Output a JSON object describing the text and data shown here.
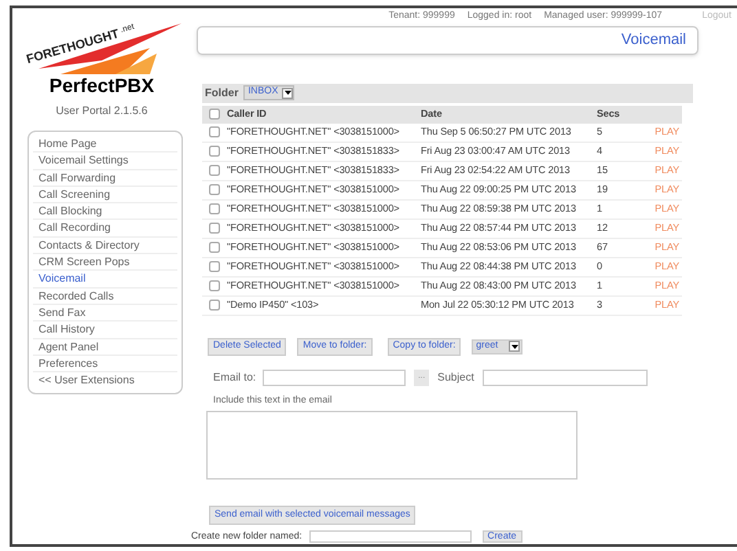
{
  "header": {
    "tenant": "Tenant: 999999",
    "logged_in": "Logged in: root",
    "managed_user": "Managed user: 999999-107",
    "logout": "Logout",
    "page_title": "Voicemail"
  },
  "logo": {
    "brand": "FORETHOUGHT",
    "suffix": ".net",
    "product": "PerfectPBX",
    "version": "User Portal 2.1.5.6"
  },
  "sidebar": {
    "items": [
      {
        "label": "Home Page",
        "selected": false
      },
      {
        "label": "Voicemail Settings",
        "selected": false
      },
      {
        "label": "Call Forwarding",
        "selected": false
      },
      {
        "label": "Call Screening",
        "selected": false
      },
      {
        "label": "Call Blocking",
        "selected": false
      },
      {
        "label": "Call Recording",
        "selected": false
      },
      {
        "label": "Contacts & Directory",
        "selected": false
      },
      {
        "label": "CRM Screen Pops",
        "selected": false
      },
      {
        "label": "Voicemail",
        "selected": true
      },
      {
        "label": "Recorded Calls",
        "selected": false
      },
      {
        "label": "Send Fax",
        "selected": false
      },
      {
        "label": "Call History",
        "selected": false
      },
      {
        "label": "Agent Panel",
        "selected": false
      },
      {
        "label": "Preferences",
        "selected": false
      },
      {
        "label": "<< User Extensions",
        "selected": false
      }
    ]
  },
  "folder": {
    "label": "Folder",
    "value": "INBOX"
  },
  "table": {
    "columns": [
      "Caller ID",
      "Date",
      "Secs"
    ],
    "header_checked": false,
    "rows": [
      {
        "caller": "\"FORETHOUGHT.NET\" <3038151000>",
        "date": "Thu Sep 5 06:50:27 PM UTC 2013",
        "secs": "5",
        "action": "PLAY",
        "checked": false
      },
      {
        "caller": "\"FORETHOUGHT.NET\" <3038151833>",
        "date": "Fri Aug 23 03:00:47 AM UTC 2013",
        "secs": "4",
        "action": "PLAY",
        "checked": false
      },
      {
        "caller": "\"FORETHOUGHT.NET\" <3038151833>",
        "date": "Fri Aug 23 02:54:22 AM UTC 2013",
        "secs": "15",
        "action": "PLAY",
        "checked": false
      },
      {
        "caller": "\"FORETHOUGHT.NET\" <3038151000>",
        "date": "Thu Aug 22 09:00:25 PM UTC 2013",
        "secs": "19",
        "action": "PLAY",
        "checked": false
      },
      {
        "caller": "\"FORETHOUGHT.NET\" <3038151000>",
        "date": "Thu Aug 22 08:59:38 PM UTC 2013",
        "secs": "1",
        "action": "PLAY",
        "checked": false
      },
      {
        "caller": "\"FORETHOUGHT.NET\" <3038151000>",
        "date": "Thu Aug 22 08:57:44 PM UTC 2013",
        "secs": "12",
        "action": "PLAY",
        "checked": false
      },
      {
        "caller": "\"FORETHOUGHT.NET\" <3038151000>",
        "date": "Thu Aug 22 08:53:06 PM UTC 2013",
        "secs": "67",
        "action": "PLAY",
        "checked": false
      },
      {
        "caller": "\"FORETHOUGHT.NET\" <3038151000>",
        "date": "Thu Aug 22 08:44:38 PM UTC 2013",
        "secs": "0",
        "action": "PLAY",
        "checked": false
      },
      {
        "caller": "\"FORETHOUGHT.NET\" <3038151000>",
        "date": "Thu Aug 22 08:43:00 PM UTC 2013",
        "secs": "1",
        "action": "PLAY",
        "checked": false
      },
      {
        "caller": "\"Demo IP450\" <103>",
        "date": "Mon Jul 22 05:30:12 PM UTC 2013",
        "secs": "3",
        "action": "PLAY",
        "checked": false
      }
    ]
  },
  "actions": {
    "delete": "Delete Selected",
    "move": "Move to folder:",
    "copy": "Copy to folder:",
    "target_folder": "greet"
  },
  "email": {
    "to_label": "Email to:",
    "browse": "...",
    "subject_label": "Subject",
    "text_label": "Include this text in the email",
    "send": "Send email with selected voicemail messages"
  },
  "create_folder": {
    "label": "Create new folder named:",
    "button": "Create"
  }
}
